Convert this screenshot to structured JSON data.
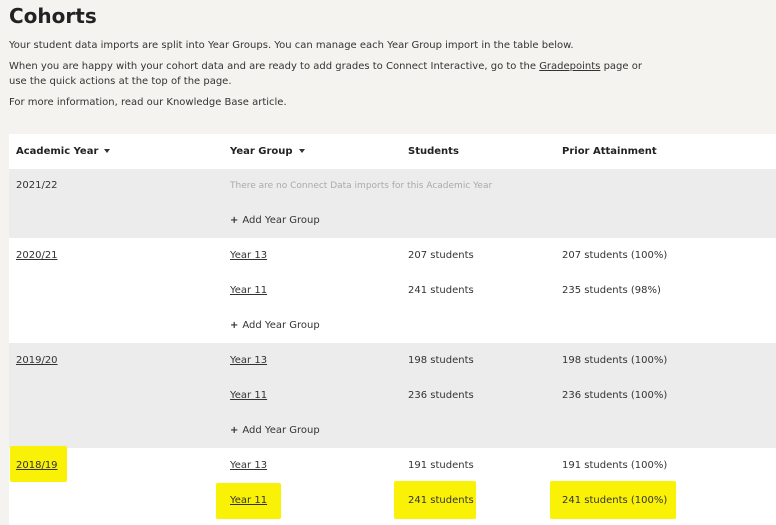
{
  "page": {
    "title": "Cohorts",
    "intro_1": "Your student data imports are split into Year Groups. You can manage each Year Group import in the table below.",
    "intro_2_before": "When you are happy with your cohort data and are ready to add grades to Connect Interactive, go to the ",
    "intro_2_link": "Gradepoints",
    "intro_2_after": " page or",
    "intro_3": "use the quick actions at the top of the page.",
    "intro_4": "For more information, read our Knowledge Base article."
  },
  "table": {
    "headers": {
      "academic_year": "Academic Year",
      "year_group": "Year Group",
      "students": "Students",
      "prior_attainment": "Prior Attainment"
    },
    "add_year_group": "Add Year Group",
    "years": [
      {
        "label": "2021/22",
        "empty_message": "There are no Connect Data imports for this Academic Year",
        "groups": []
      },
      {
        "label": "2020/21",
        "groups": [
          {
            "name": "Year 13",
            "students": "207 students",
            "prior": "207 students (100%)"
          },
          {
            "name": "Year 11",
            "students": "241 students",
            "prior": "235 students (98%)"
          }
        ]
      },
      {
        "label": "2019/20",
        "groups": [
          {
            "name": "Year 13",
            "students": "198 students",
            "prior": "198 students (100%)"
          },
          {
            "name": "Year 11",
            "students": "236 students",
            "prior": "236 students (100%)"
          }
        ]
      },
      {
        "label": "2018/19",
        "groups": [
          {
            "name": "Year 13",
            "students": "191 students",
            "prior": "191 students (100%)"
          },
          {
            "name": "Year 11",
            "students": "241 students",
            "prior": "241 students (100%)"
          }
        ]
      }
    ]
  },
  "highlight_color": "#f9f106"
}
